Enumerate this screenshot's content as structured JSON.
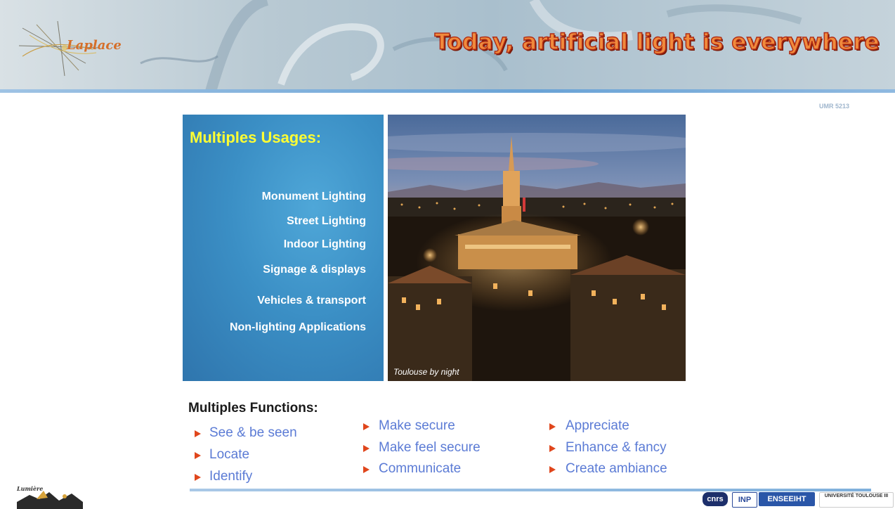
{
  "header": {
    "title": "Today, artificial light is everywhere",
    "logo_text": "Laplace",
    "umr_label": "UMR 5213"
  },
  "usages": {
    "title": "Multiples Usages:",
    "items": [
      "Monument Lighting",
      "Street Lighting",
      "Indoor Lighting",
      "Signage & displays",
      "Vehicles & transport",
      "Non-lighting Applications"
    ]
  },
  "photo": {
    "caption": "Toulouse by night"
  },
  "functions": {
    "title": "Multiples Functions:",
    "col1": [
      "See & be seen",
      "Locate",
      "Identify"
    ],
    "col2": [
      "Make secure",
      "Make feel secure",
      "Communicate"
    ],
    "col3": [
      "Appreciate",
      "Enhance & fancy",
      "Create ambiance"
    ]
  },
  "footer": {
    "left_logo_text": "Lumière",
    "logos": [
      "cnrs",
      "INP",
      "ENSEEIHT",
      "UNIVERSITÉ TOULOUSE III"
    ]
  },
  "colors": {
    "title_fill": "#f08a3c",
    "title_outline": "#b02b14",
    "usage_title": "#ffff33",
    "function_text": "#5b7bd5",
    "bullet": "#e0461c",
    "panel_blue": "#3b8fc5"
  }
}
